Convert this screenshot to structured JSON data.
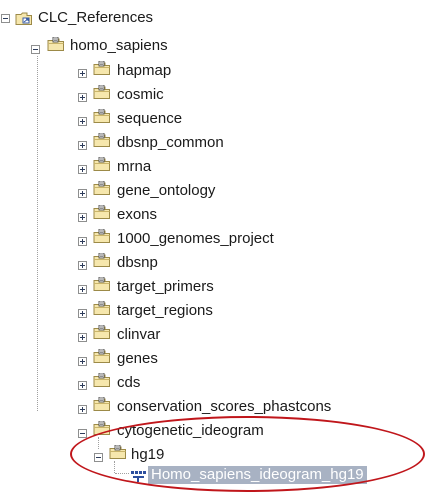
{
  "tree": {
    "root": {
      "label": "CLC_References",
      "expanded": true
    },
    "level1": {
      "label": "homo_sapiens",
      "expanded": true
    },
    "children": [
      {
        "label": "hapmap"
      },
      {
        "label": "cosmic"
      },
      {
        "label": "sequence"
      },
      {
        "label": "dbsnp_common"
      },
      {
        "label": "mrna"
      },
      {
        "label": "gene_ontology"
      },
      {
        "label": "exons"
      },
      {
        "label": "1000_genomes_project"
      },
      {
        "label": "dbsnp"
      },
      {
        "label": "target_primers"
      },
      {
        "label": "target_regions"
      },
      {
        "label": "clinvar"
      },
      {
        "label": "genes"
      },
      {
        "label": "cds"
      },
      {
        "label": "conservation_scores_phastcons"
      }
    ],
    "expanded_child": {
      "label": "cytogenetic_ideogram"
    },
    "subfolder": {
      "label": "hg19"
    },
    "selected_item": {
      "label": "Homo_sapiens_ideogram_hg19"
    }
  },
  "colors": {
    "highlight_ring": "#c0161b",
    "selection": "#a8b2c3",
    "folder": "#f3dc8a"
  },
  "icons": [
    "expand-plus-icon",
    "collapse-minus-icon",
    "folder-icon",
    "root-folder-icon",
    "sequence-track-icon"
  ]
}
